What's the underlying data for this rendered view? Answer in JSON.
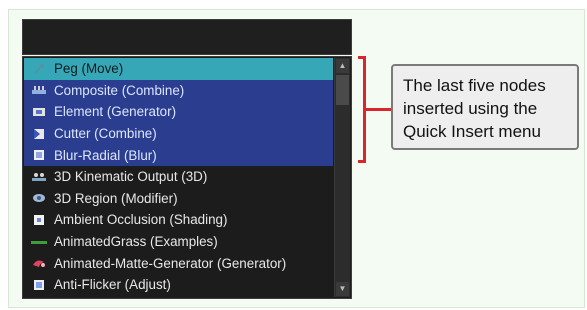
{
  "callout": {
    "text": "The last five nodes inserted using the Quick Insert menu"
  },
  "search": {
    "value": ""
  },
  "items": [
    {
      "label": "Peg (Move)",
      "icon": "peg-icon",
      "state": "selected"
    },
    {
      "label": "Composite (Combine)",
      "icon": "composite-icon",
      "state": "recent"
    },
    {
      "label": "Element (Generator)",
      "icon": "element-icon",
      "state": "recent"
    },
    {
      "label": "Cutter (Combine)",
      "icon": "cutter-icon",
      "state": "recent"
    },
    {
      "label": "Blur-Radial (Blur)",
      "icon": "blur-icon",
      "state": "recent"
    },
    {
      "label": "3D Kinematic Output (3D)",
      "icon": "kinematic-icon",
      "state": "normal"
    },
    {
      "label": "3D Region (Modifier)",
      "icon": "region-icon",
      "state": "normal"
    },
    {
      "label": "Ambient Occlusion (Shading)",
      "icon": "occlusion-icon",
      "state": "normal"
    },
    {
      "label": "AnimatedGrass (Examples)",
      "icon": "grass-icon",
      "state": "normal"
    },
    {
      "label": "Animated-Matte-Generator (Generator)",
      "icon": "matte-icon",
      "state": "normal"
    },
    {
      "label": "Anti-Flicker (Adjust)",
      "icon": "flicker-icon",
      "state": "normal"
    }
  ],
  "colors": {
    "selected": "#36a7b7",
    "recent": "#2b3d8f",
    "highlight": "#d9262e"
  }
}
